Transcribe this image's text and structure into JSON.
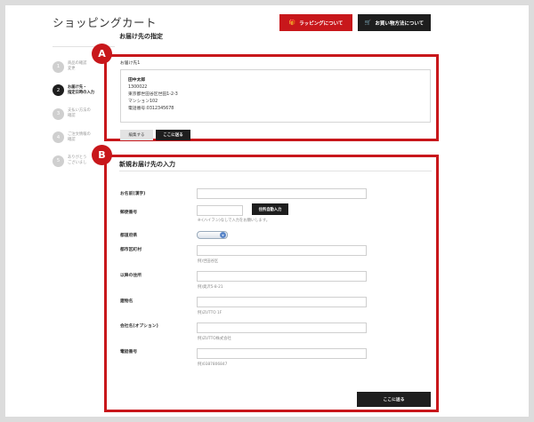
{
  "page_title": "ショッピングカート",
  "top_buttons": {
    "wrapping": "ラッピングについて",
    "payment": "お買い物方法について"
  },
  "steps": [
    {
      "num": "1",
      "text": "商品の確認\n変更"
    },
    {
      "num": "2",
      "text": "お届け先・\n指定日時の入力"
    },
    {
      "num": "3",
      "text": "支払い方法の\n確認"
    },
    {
      "num": "4",
      "text": "ご注文情報の\n確認"
    },
    {
      "num": "5",
      "text": "ありがとう\nございまし"
    }
  ],
  "badges": {
    "a": "A",
    "b": "B"
  },
  "delivery": {
    "section_title": "お届け先の指定",
    "address_label": "お届け先1",
    "name": "田中太郎",
    "zip": "1300022",
    "address": "東京都世田谷区世田1-2-3",
    "building": "マンション102",
    "phone": "電話番号:0312345678",
    "edit_button": "編集する",
    "send_here_button": "ここに送る"
  },
  "new_address": {
    "section_title": "新規お届け先の入力",
    "fields": {
      "name": {
        "label": "お名前(漢字)"
      },
      "zip": {
        "label": "郵便番号",
        "hint": "※-(ハイフン)なしで入力をお願いします。",
        "button": "住所自動入力"
      },
      "prefecture": {
        "label": "都道府県"
      },
      "city": {
        "label": "都市区町村",
        "hint": "例)世田谷区"
      },
      "street": {
        "label": "以降の住所",
        "hint": "例)奥沢5-8-21"
      },
      "building": {
        "label": "建物名",
        "hint": "例)ZUTTO 1F"
      },
      "company": {
        "label": "会社名(オプション)",
        "hint": "例)ZUTTO株式会社"
      },
      "phone": {
        "label": "電話番号",
        "hint": "例)0387806847"
      }
    },
    "submit_button": "ここに送る"
  }
}
